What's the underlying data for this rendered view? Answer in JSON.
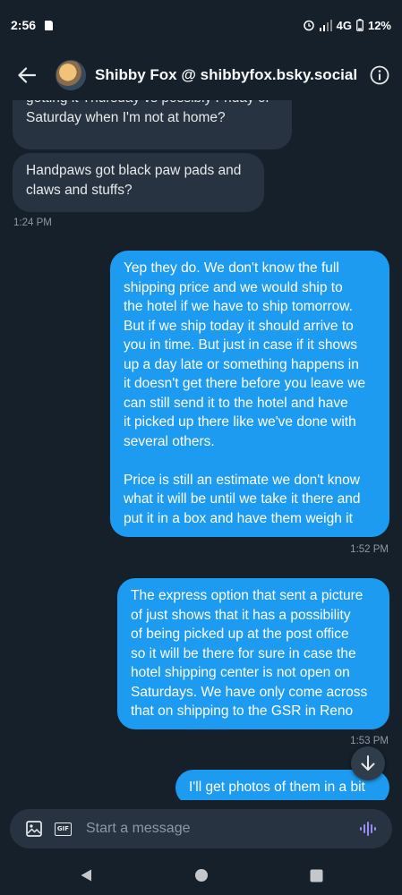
{
  "status_bar": {
    "time": "2:56",
    "network": "4G",
    "battery": "12%"
  },
  "header": {
    "title": "Shibby Fox @ shibbyfox.bsky.social"
  },
  "messages": [
    {
      "direction": "in",
      "text": "getting it Thursday vs possibly Friday or\nSaturday when I'm not at home?"
    },
    {
      "direction": "in",
      "text": "Handpaws got black paw pads and\nclaws and stuffs?"
    },
    {
      "direction": "time",
      "text": "1:24 PM"
    },
    {
      "direction": "out",
      "text": "Yep they do. We don't know the full\nshipping price and we would ship to\nthe hotel if we have to ship tomorrow.\nBut if we ship today it should arrive to\nyou in time. But just in case if it shows\nup a day late or something happens in\nit doesn't get there before you leave we\ncan still send it to the hotel and have\nit picked up there like we've done with\nseveral others.\n\nPrice is still an estimate we don't know\nwhat it will be until we take it there and\nput it in a box and have them weigh it"
    },
    {
      "direction": "time",
      "text": "1:52 PM"
    },
    {
      "direction": "out",
      "text": "The express option that sent a picture\nof just shows that it has a possibility\nof being picked up at the post office\nso it will be there for sure in case the\nhotel shipping center is not open on\nSaturdays. We have only come across\nthat on shipping to the GSR in Reno"
    },
    {
      "direction": "time",
      "text": "1:53 PM"
    },
    {
      "direction": "out",
      "text": "I'll get photos of them in a bit"
    }
  ],
  "composer": {
    "placeholder": "Start a message",
    "gif_label": "GIF"
  },
  "colors": {
    "background": "#15202b",
    "incoming_bubble": "#273340",
    "outgoing_bubble": "#1d9bf0",
    "voice_icon": "#9b8cf5"
  }
}
